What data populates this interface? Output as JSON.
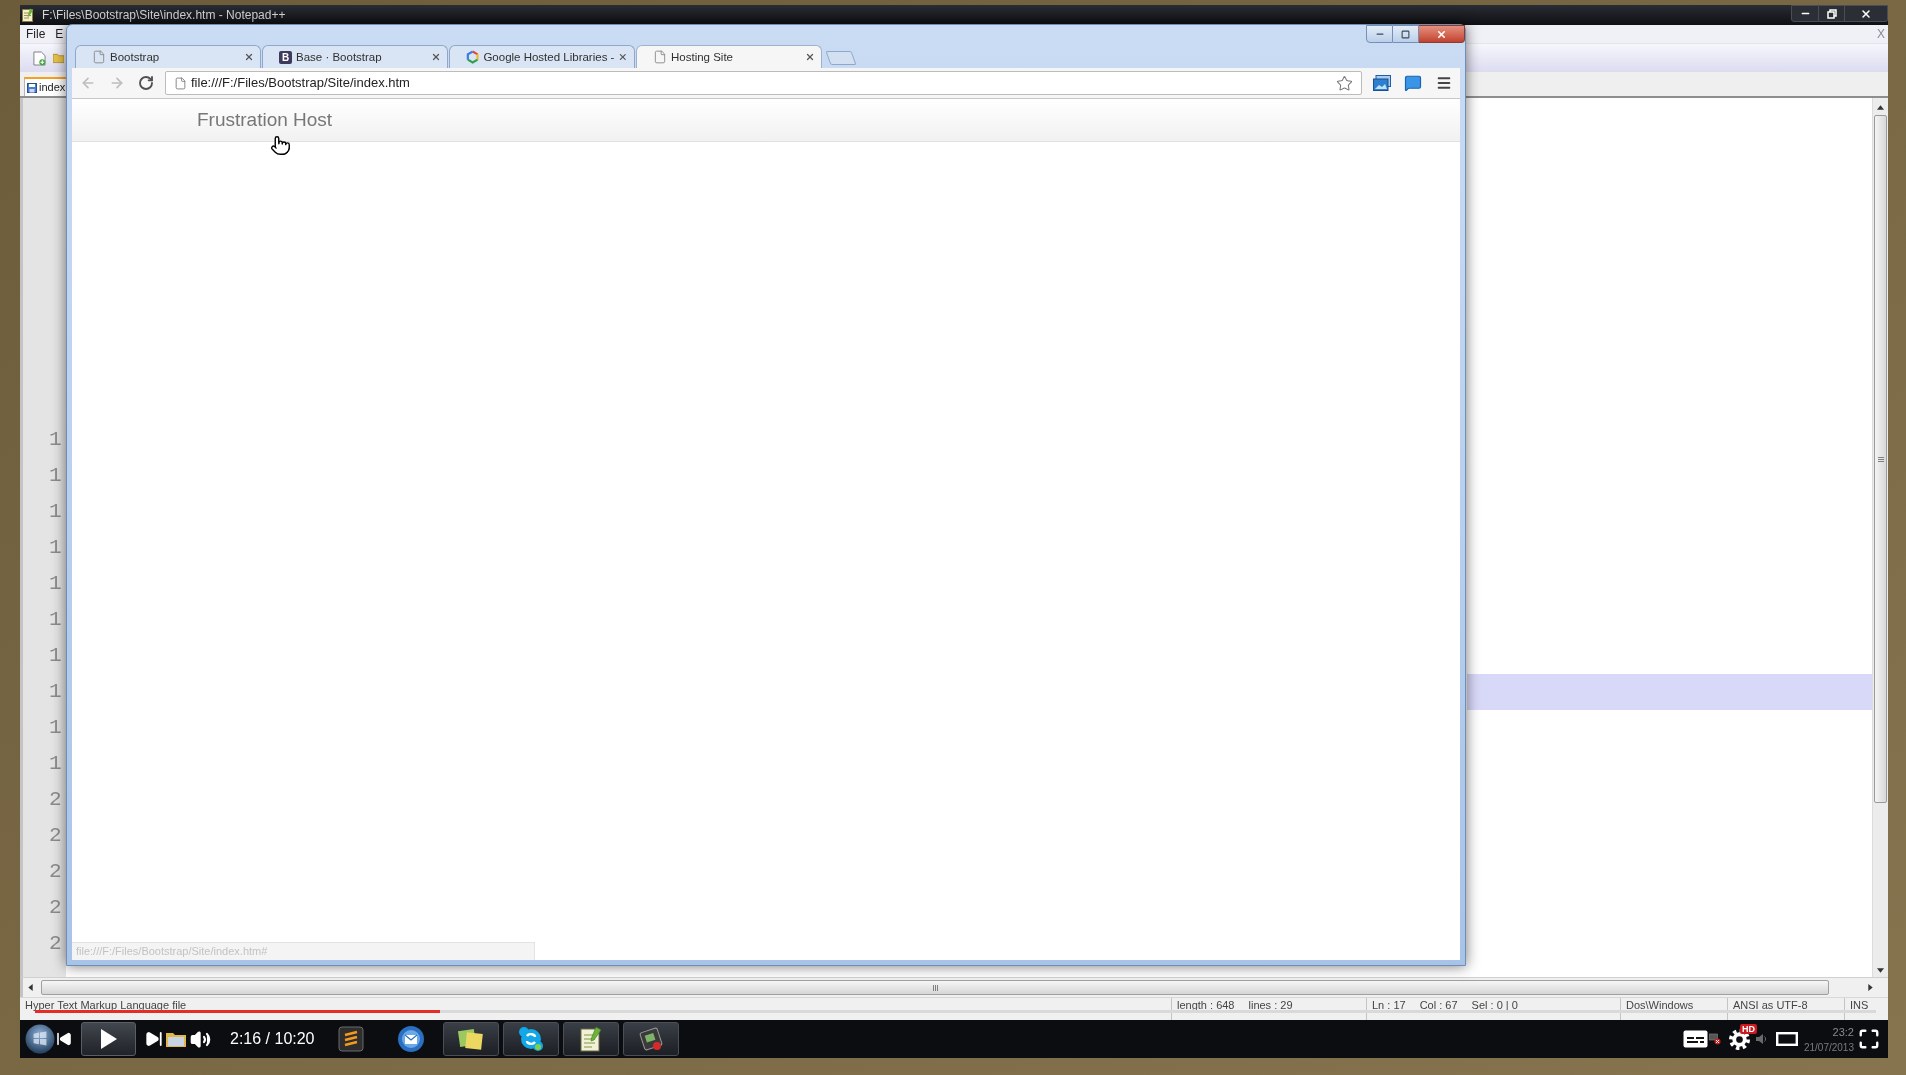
{
  "notepad": {
    "title": "F:\\Files\\Bootstrap\\Site\\index.htm - Notepad++",
    "menu": [
      "File",
      "E"
    ],
    "close_label": "X",
    "tabs": [
      {
        "label": "index",
        "selected": true
      }
    ],
    "lines": [
      {
        "number": "1",
        "current": false
      },
      {
        "number": "1",
        "current": false
      },
      {
        "number": "1",
        "current": false
      },
      {
        "number": "1",
        "current": false
      },
      {
        "number": "1",
        "current": false
      },
      {
        "number": "1",
        "current": false
      },
      {
        "number": "1",
        "current": false
      },
      {
        "number": "1",
        "current": true
      },
      {
        "number": "1",
        "current": false
      },
      {
        "number": "1",
        "current": false
      },
      {
        "number": "2",
        "current": false
      },
      {
        "number": "2",
        "current": false
      },
      {
        "number": "2",
        "current": false
      },
      {
        "number": "2",
        "current": false
      },
      {
        "number": "2",
        "current": false
      }
    ],
    "status_bar": [
      [
        "Hyper Text Markup Language file"
      ],
      [
        "length : 648",
        "lines : 29"
      ],
      [
        "Ln : 17",
        "Col : 67",
        "Sel : 0 | 0"
      ],
      [
        "Dos\\Windows"
      ],
      [
        "ANSI as UTF-8"
      ],
      [
        "INS"
      ]
    ]
  },
  "browser": {
    "tabs": [
      {
        "title": "Bootstrap",
        "kind": "page",
        "selected": false
      },
      {
        "title": "Base · Bootstrap",
        "kind": "letter",
        "letter": "B",
        "selected": false
      },
      {
        "title": "Google Hosted Libraries -",
        "kind": "hexagon",
        "selected": false
      },
      {
        "title": "Hosting Site",
        "kind": "page",
        "selected": true
      }
    ],
    "back_disabled": true,
    "forward_disabled": true,
    "url": "file:///F:/Files/Bootstrap/Site/index.htm",
    "bookmarked": false,
    "brand": "Frustration Host",
    "status_url": "file:///F:/Files/Bootstrap/Site/index.htm#"
  },
  "player": {
    "playing": false,
    "time": "2:16 / 10:20",
    "progress": {
      "level": 0.22
    },
    "quality": "HD"
  },
  "taskbar": {
    "apps": [
      {
        "kind": "editor",
        "running": false
      },
      {
        "kind": "mail",
        "running": false
      },
      {
        "kind": "notes",
        "running": true
      },
      {
        "kind": "chat",
        "running": true
      },
      {
        "kind": "notepad",
        "running": true
      },
      {
        "kind": "tablet",
        "running": true
      }
    ],
    "clock": "23:2",
    "date": "21/07/2013"
  }
}
